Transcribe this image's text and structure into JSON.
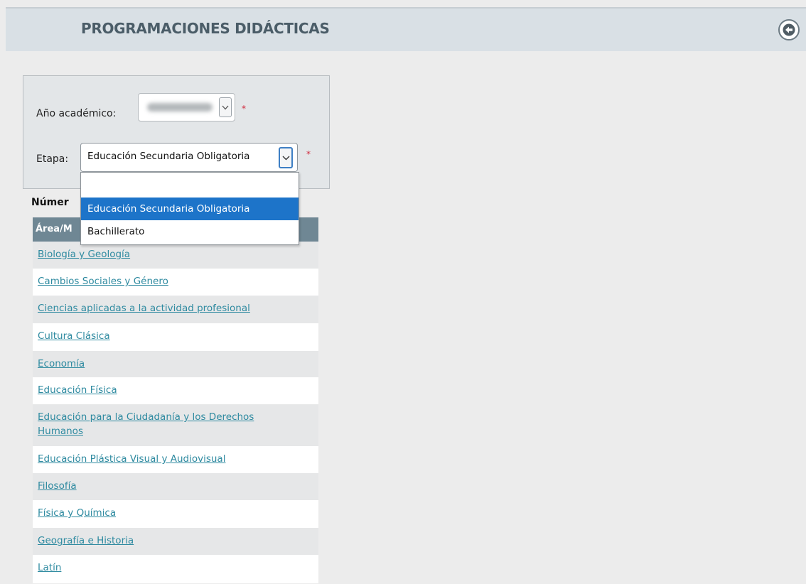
{
  "header": {
    "title": "PROGRAMACIONES DIDÁCTICAS",
    "back_icon": "arrow-left-circle-icon"
  },
  "filters": {
    "academic_year_label": "Año académico:",
    "academic_year_value": "",
    "stage_label": "Etapa:",
    "stage_value": "Educación Secundaria Obligatoria",
    "required_mark": "*"
  },
  "stage_dropdown": {
    "options": [
      "",
      "Educación Secundaria Obligatoria",
      "Bachillerato"
    ],
    "selected_index": 1
  },
  "count_label": "Númer",
  "table": {
    "header_partial": "Área/M",
    "rows": [
      "Biología y Geología",
      "Cambios Sociales y Género",
      "Ciencias aplicadas a la actividad profesional",
      "Cultura Clásica",
      "Economía",
      "Educación Física",
      "Educación para la Ciudadanía y los Derechos Humanos",
      "Educación Plástica Visual y Audiovisual",
      "Filosofía",
      "Física y Química",
      "Geografía e Historia",
      "Latín"
    ]
  },
  "colors": {
    "header_bg": "#d9e0e5",
    "title_text": "#4b5d68",
    "table_header_bg": "#6f8794",
    "link": "#2e8aa0",
    "selected_option": "#1d74c9",
    "required": "#d0283b"
  }
}
